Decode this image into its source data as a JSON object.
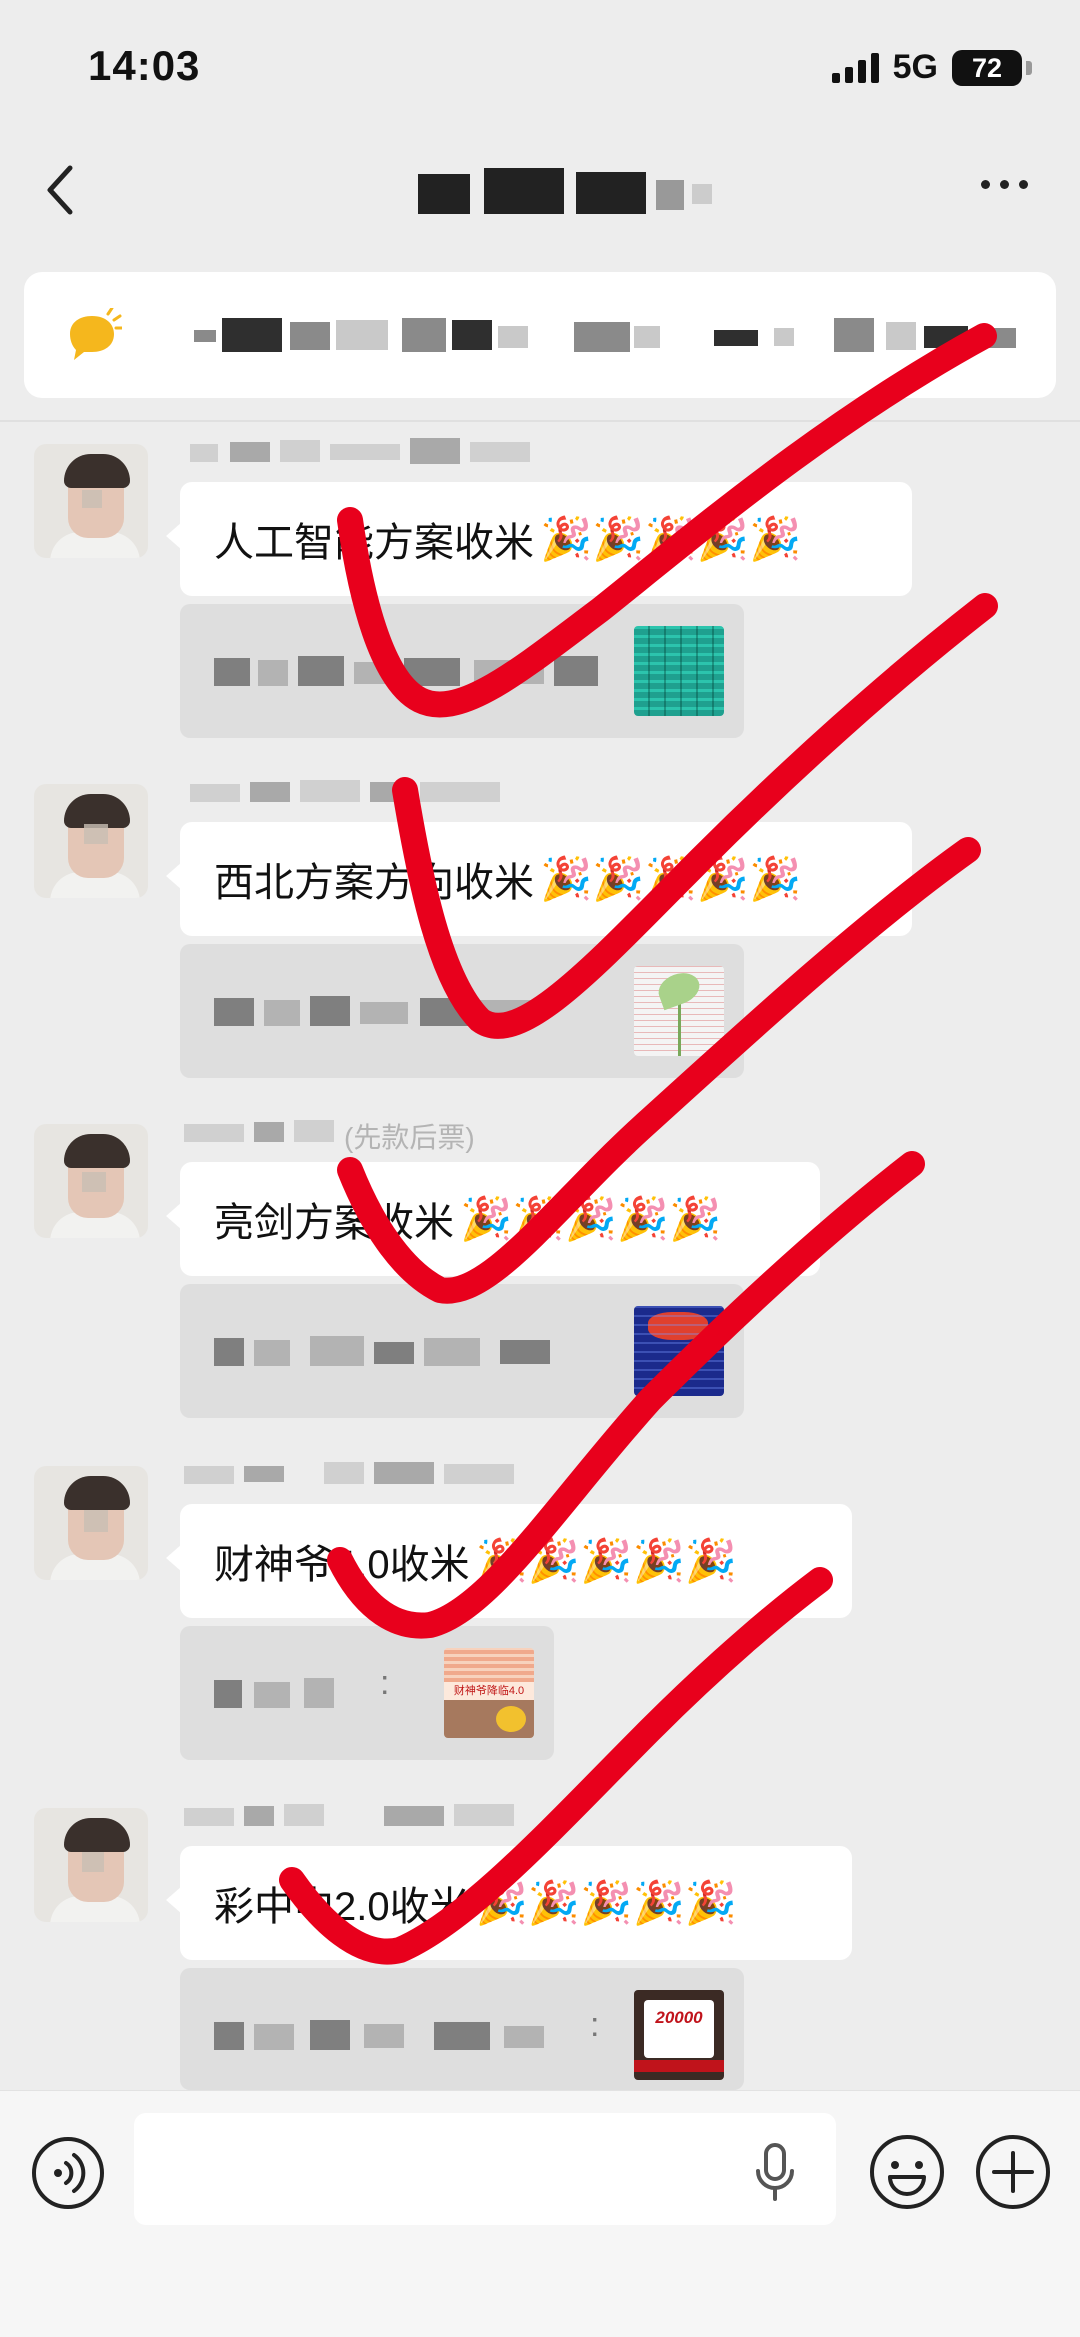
{
  "status_bar": {
    "time": "14:03",
    "network": "5G",
    "battery": "72"
  },
  "messages": [
    {
      "text": "人工智能方案收米",
      "party": "🎉🎉🎉🎉🎉"
    },
    {
      "text": "西北方案方向收米",
      "party": "🎉🎉🎉🎉🎉"
    },
    {
      "text": "亮剑方案收米",
      "party": "🎉🎉🎉🎉🎉",
      "nick_tail": "(先款后票)"
    },
    {
      "text": "财神爷4.0收米",
      "party": "🎉🎉🎉🎉🎉",
      "quote_colon": ":",
      "thumb_label": "财神爷降临4.0"
    },
    {
      "text": "彩中中2.0收米",
      "party": "🎉🎉🎉🎉🎉",
      "quote_colon": ":",
      "thumb_label": "20000"
    }
  ],
  "input": {
    "placeholder": ""
  },
  "icons": {
    "back": "chevron-left-icon",
    "more": "more-horizontal-icon",
    "announcement": "speech-bubble-icon",
    "voice": "voice-wave-icon",
    "mic": "microphone-icon",
    "emoji": "smiley-icon",
    "plus": "plus-circle-icon"
  },
  "colors": {
    "background": "#ededed",
    "bubble": "#ffffff",
    "quote": "#dedede",
    "check_marks": "#e8001c",
    "announce_icon": "#f5b71d"
  }
}
